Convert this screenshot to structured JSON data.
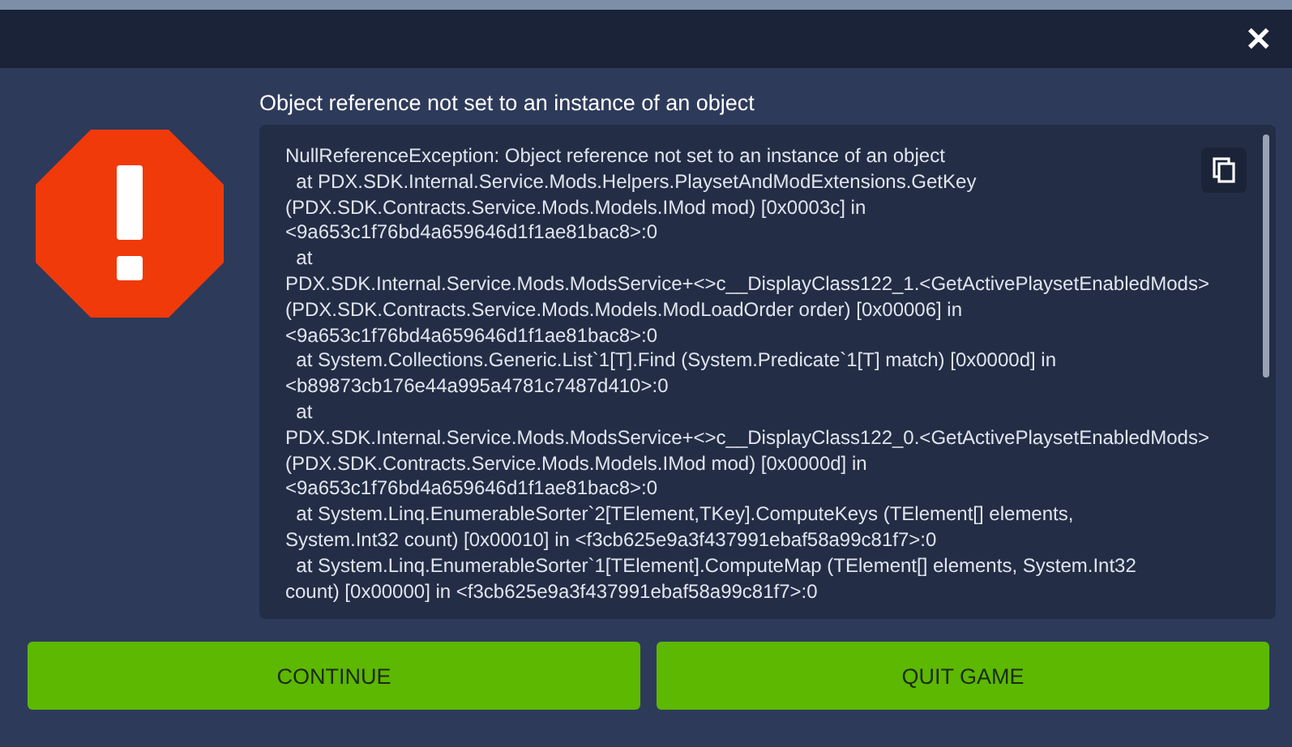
{
  "dialog": {
    "close": "✕",
    "title": "Object reference not set to an instance of an object",
    "log_lines": [
      "NullReferenceException: Object reference not set to an instance of an object",
      "  at PDX.SDK.Internal.Service.Mods.Helpers.PlaysetAndModExtensions.GetKey",
      "(PDX.SDK.Contracts.Service.Mods.Models.IMod mod) [0x0003c] in",
      "<9a653c1f76bd4a659646d1f1ae81bac8>:0",
      "  at",
      "PDX.SDK.Internal.Service.Mods.ModsService+<>c__DisplayClass122_1.<GetActivePlaysetEnabledMods>",
      "(PDX.SDK.Contracts.Service.Mods.Models.ModLoadOrder order) [0x00006] in",
      "<9a653c1f76bd4a659646d1f1ae81bac8>:0",
      "  at System.Collections.Generic.List`1[T].Find (System.Predicate`1[T] match) [0x0000d] in",
      "<b89873cb176e44a995a4781c7487d410>:0",
      "  at",
      "PDX.SDK.Internal.Service.Mods.ModsService+<>c__DisplayClass122_0.<GetActivePlaysetEnabledMods>",
      "(PDX.SDK.Contracts.Service.Mods.Models.IMod mod) [0x0000d] in",
      "<9a653c1f76bd4a659646d1f1ae81bac8>:0",
      "  at System.Linq.EnumerableSorter`2[TElement,TKey].ComputeKeys (TElement[] elements,",
      "System.Int32 count) [0x00010] in <f3cb625e9a3f437991ebaf58a99c81f7>:0",
      "  at System.Linq.EnumerableSorter`1[TElement].ComputeMap (TElement[] elements, System.Int32",
      "count) [0x00000] in <f3cb625e9a3f437991ebaf58a99c81f7>:0"
    ],
    "buttons": [
      "CONTINUE",
      "QUIT GAME"
    ]
  }
}
